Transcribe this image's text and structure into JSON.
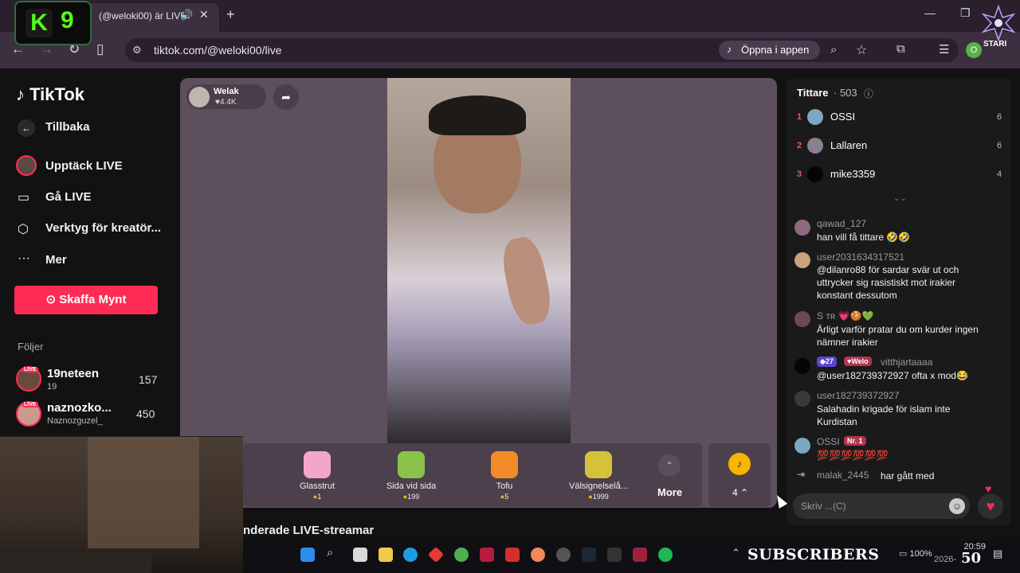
{
  "browser": {
    "tab_title": "(@weloki00) är LIVE",
    "url": "tiktok.com/@weloki00/live",
    "open_app_label": "Öppna i appen",
    "profile_initial": "O"
  },
  "overlay": {
    "k9_letter": "K",
    "k9_number": "9",
    "star_label": "STARI",
    "subscribers_text": "SUBSCRIBERS",
    "subscribers_count": "50"
  },
  "sidebar": {
    "logo": "TikTok",
    "back_label": "Tillbaka",
    "items": [
      {
        "label": "Upptäck LIVE",
        "icon": "live-avatar-icon"
      },
      {
        "label": "Gå LIVE",
        "icon": "camera-icon"
      },
      {
        "label": "Verktyg för kreatör...",
        "icon": "creator-tools-icon"
      },
      {
        "label": "Mer",
        "icon": "more-dots-icon"
      }
    ],
    "coin_button": "Skaffa Mynt",
    "following_header": "Följer",
    "following": [
      {
        "name": "19neteen",
        "sub": "19",
        "count": "157",
        "badge": "LIVE"
      },
      {
        "name": "naznozko...",
        "sub": "Naznozguzel_",
        "count": "450",
        "badge": "LIVE"
      }
    ]
  },
  "stream": {
    "host_name": "Welak",
    "host_likes": "4.4K",
    "gifts": [
      {
        "name": "Glasstrut",
        "price": "1",
        "color": "#f4a6c8"
      },
      {
        "name": "Sida vid sida",
        "price": "199",
        "color": "#8bc34a"
      },
      {
        "name": "Tofu",
        "price": "5",
        "color": "#f28c28"
      },
      {
        "name": "Välsignelselå...",
        "price": "1999",
        "color": "#d4c33a"
      }
    ],
    "more_label": "More",
    "coin_count": "4",
    "recommended_text": "nderade LIVE-streamar"
  },
  "chat": {
    "viewers_label": "Tittare",
    "viewers_count": "· 503",
    "ranking": [
      {
        "rank": "1",
        "name": "OSSI",
        "score": "6"
      },
      {
        "rank": "2",
        "name": "Lallaren",
        "score": "6"
      },
      {
        "rank": "3",
        "name": "mike3359",
        "score": "4"
      }
    ],
    "messages": [
      {
        "user": "qawad_127",
        "text": "han vill få tittare 🤣🤣"
      },
      {
        "user": "user2031634317521",
        "text": "@dilanro88 för sardar svär ut och uttrycker sig rasistiskt mot irakier konstant dessutom"
      },
      {
        "user": "S ᴛʀ 💗🍪💚",
        "text": "Ärligt varför pratar du om kurder ingen nämner irakier"
      },
      {
        "user": "vitthjartaaaa",
        "badge1": "27",
        "badge2": "Welo",
        "text": "@user182739372927 ofta x mod😂"
      },
      {
        "user": "user182739372927",
        "text": "Salahadin krigade för islam inte Kurdistan"
      },
      {
        "user": "OSSI",
        "badge1": "Nr. 1",
        "text": "💯💯💯💯💯💯"
      }
    ],
    "join_user": "malak_2445",
    "join_text": "har gått med",
    "input_placeholder": "Skriv ...(C)"
  },
  "taskbar": {
    "battery": "100%",
    "time": "20:59",
    "date": "2026-"
  }
}
